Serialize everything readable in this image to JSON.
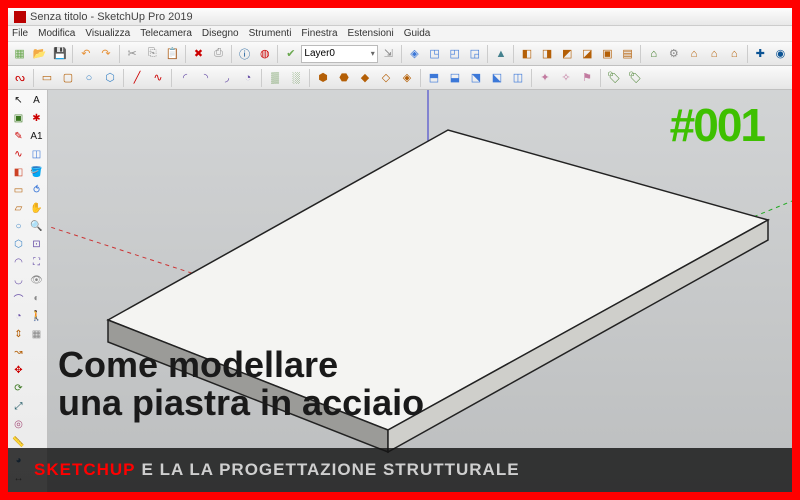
{
  "window": {
    "title": "Senza titolo - SketchUp Pro 2019"
  },
  "menu": {
    "items": [
      "File",
      "Modifica",
      "Visualizza",
      "Telecamera",
      "Disegno",
      "Strumenti",
      "Finestra",
      "Estensioni",
      "Guida"
    ]
  },
  "layer": {
    "current": "Layer0"
  },
  "overlay": {
    "episode": "#001",
    "title_line1": "Come modellare",
    "title_line2": "una piastra in acciaio",
    "strip_brand": "SKETCHUP",
    "strip_rest": "E LA LA PROGETTAZIONE STRUTTURALE"
  },
  "toolbar_main": [
    {
      "name": "new-icon",
      "glyph": "▦",
      "cls": "c-new"
    },
    {
      "name": "open-icon",
      "glyph": "📂",
      "cls": "c-open"
    },
    {
      "name": "save-icon",
      "glyph": "💾",
      "cls": "c-save"
    },
    {
      "name": "sep"
    },
    {
      "name": "undo-icon",
      "glyph": "↶",
      "cls": "c-undo"
    },
    {
      "name": "redo-icon",
      "glyph": "↷",
      "cls": "c-undo"
    },
    {
      "name": "sep"
    },
    {
      "name": "cut-icon",
      "glyph": "✂",
      "cls": "c-cut"
    },
    {
      "name": "copy-icon",
      "glyph": "⎘",
      "cls": "c-cut"
    },
    {
      "name": "paste-icon",
      "glyph": "📋",
      "cls": "c-paste"
    },
    {
      "name": "sep"
    },
    {
      "name": "delete-icon",
      "glyph": "✖",
      "cls": "c-del"
    },
    {
      "name": "print-icon",
      "glyph": "⎙",
      "cls": "c-cut"
    },
    {
      "name": "sep"
    },
    {
      "name": "model-info-icon",
      "glyph": "ⓘ",
      "cls": "c-tag"
    },
    {
      "name": "paint-icon",
      "glyph": "◍",
      "cls": "c-del"
    },
    {
      "name": "sep"
    },
    {
      "name": "layer-visible-icon",
      "glyph": "✔",
      "cls": "c-new"
    },
    {
      "name": "layer-selector"
    },
    {
      "name": "layer-manage-icon",
      "glyph": "⇲",
      "cls": "c-cut"
    },
    {
      "name": "sep"
    },
    {
      "name": "iso-icon",
      "glyph": "◈",
      "cls": "c-orbit"
    },
    {
      "name": "top-icon",
      "glyph": "◳",
      "cls": "c-orbit"
    },
    {
      "name": "front-icon",
      "glyph": "◰",
      "cls": "c-orbit"
    },
    {
      "name": "right-icon",
      "glyph": "◲",
      "cls": "c-orbit"
    },
    {
      "name": "sep"
    },
    {
      "name": "mirror-icon",
      "glyph": "▲",
      "cls": "c-mirror"
    },
    {
      "name": "sep"
    },
    {
      "name": "style1-icon",
      "glyph": "◧",
      "cls": "c-box"
    },
    {
      "name": "style2-icon",
      "glyph": "◨",
      "cls": "c-box"
    },
    {
      "name": "style3-icon",
      "glyph": "◩",
      "cls": "c-box"
    },
    {
      "name": "style4-icon",
      "glyph": "◪",
      "cls": "c-box"
    },
    {
      "name": "style5-icon",
      "glyph": "▣",
      "cls": "c-box"
    },
    {
      "name": "style6-icon",
      "glyph": "▤",
      "cls": "c-box"
    },
    {
      "name": "sep"
    },
    {
      "name": "warehouse-icon",
      "glyph": "⌂",
      "cls": "c-comp"
    },
    {
      "name": "extension-icon",
      "glyph": "⚙",
      "cls": "c-cut"
    },
    {
      "name": "house1-icon",
      "glyph": "⌂",
      "cls": "c-box"
    },
    {
      "name": "house2-icon",
      "glyph": "⌂",
      "cls": "c-box"
    },
    {
      "name": "house3-icon",
      "glyph": "⌂",
      "cls": "c-box"
    },
    {
      "name": "sep"
    },
    {
      "name": "addloc-icon",
      "glyph": "✚",
      "cls": "c-tag"
    },
    {
      "name": "geo-icon",
      "glyph": "◉",
      "cls": "c-tag"
    }
  ],
  "toolbar_sec": [
    {
      "name": "weld-icon",
      "glyph": "ᔓ",
      "cls": "c-del"
    },
    {
      "name": "sep"
    },
    {
      "name": "sb-rect-icon",
      "glyph": "▭",
      "cls": "c-rect"
    },
    {
      "name": "sb-rrect-icon",
      "glyph": "▢",
      "cls": "c-rect"
    },
    {
      "name": "sb-circle-icon",
      "glyph": "○",
      "cls": "c-circ"
    },
    {
      "name": "sb-poly-icon",
      "glyph": "⬡",
      "cls": "c-circ"
    },
    {
      "name": "sep"
    },
    {
      "name": "sb-line-icon",
      "glyph": "╱",
      "cls": "c-pencil"
    },
    {
      "name": "sb-free-icon",
      "glyph": "∿",
      "cls": "c-pencil"
    },
    {
      "name": "sep"
    },
    {
      "name": "sb-arc1-icon",
      "glyph": "◜",
      "cls": "c-arc"
    },
    {
      "name": "sb-arc2-icon",
      "glyph": "◝",
      "cls": "c-arc"
    },
    {
      "name": "sb-arc3-icon",
      "glyph": "◞",
      "cls": "c-arc"
    },
    {
      "name": "sb-pie-icon",
      "glyph": "◔",
      "cls": "c-arc"
    },
    {
      "name": "sep"
    },
    {
      "name": "sandbox1-icon",
      "glyph": "▒",
      "cls": "c-comp"
    },
    {
      "name": "sandbox2-icon",
      "glyph": "░",
      "cls": "c-comp"
    },
    {
      "name": "sep"
    },
    {
      "name": "sand-smoove-icon",
      "glyph": "⬢",
      "cls": "c-box"
    },
    {
      "name": "sand-stamp-icon",
      "glyph": "⬣",
      "cls": "c-box"
    },
    {
      "name": "sand-drape-icon",
      "glyph": "◆",
      "cls": "c-box"
    },
    {
      "name": "sand-add-icon",
      "glyph": "◇",
      "cls": "c-box"
    },
    {
      "name": "sand-flip-icon",
      "glyph": "◈",
      "cls": "c-box"
    },
    {
      "name": "sep"
    },
    {
      "name": "solid1-icon",
      "glyph": "⬒",
      "cls": "c-orbit"
    },
    {
      "name": "solid2-icon",
      "glyph": "⬓",
      "cls": "c-orbit"
    },
    {
      "name": "solid3-icon",
      "glyph": "⬔",
      "cls": "c-orbit"
    },
    {
      "name": "solid4-icon",
      "glyph": "⬕",
      "cls": "c-orbit"
    },
    {
      "name": "solid5-icon",
      "glyph": "◫",
      "cls": "c-orbit"
    },
    {
      "name": "sep"
    },
    {
      "name": "dyn1-icon",
      "glyph": "✦",
      "cls": "c-paste"
    },
    {
      "name": "dyn2-icon",
      "glyph": "✧",
      "cls": "c-paste"
    },
    {
      "name": "dyn3-icon",
      "glyph": "⚑",
      "cls": "c-paste"
    },
    {
      "name": "sep"
    },
    {
      "name": "tag1-icon",
      "glyph": "🏷",
      "cls": "c-comp"
    },
    {
      "name": "tag2-icon",
      "glyph": "🏷",
      "cls": "c-comp"
    }
  ],
  "sidebar": [
    {
      "name": "select-icon",
      "glyph": "↖",
      "cls": "c-sel"
    },
    {
      "name": "makecomp-icon",
      "glyph": "▣",
      "cls": "c-comp"
    },
    {
      "name": "line-icon",
      "glyph": "✎",
      "cls": "c-pencil"
    },
    {
      "name": "freehand-icon",
      "glyph": "∿",
      "cls": "c-pencil"
    },
    {
      "name": "eraser-icon",
      "glyph": "◧",
      "cls": "c-erase"
    },
    {
      "name": "rectangle-icon",
      "glyph": "▭",
      "cls": "c-rect"
    },
    {
      "name": "rotrect-icon",
      "glyph": "▱",
      "cls": "c-rect"
    },
    {
      "name": "circle-icon",
      "glyph": "○",
      "cls": "c-circ"
    },
    {
      "name": "polygon-icon",
      "glyph": "⬡",
      "cls": "c-circ"
    },
    {
      "name": "arc-icon",
      "glyph": "◠",
      "cls": "c-arc"
    },
    {
      "name": "arc2pt-icon",
      "glyph": "◡",
      "cls": "c-arc"
    },
    {
      "name": "arc3pt-icon",
      "glyph": "⌒",
      "cls": "c-arc"
    },
    {
      "name": "pie-icon",
      "glyph": "◔",
      "cls": "c-arc"
    },
    {
      "name": "pushpull-icon",
      "glyph": "⇕",
      "cls": "c-rect"
    },
    {
      "name": "followme-icon",
      "glyph": "↝",
      "cls": "c-rect"
    },
    {
      "name": "move-icon",
      "glyph": "✥",
      "cls": "c-move"
    },
    {
      "name": "rotate-icon",
      "glyph": "⟳",
      "cls": "c-rot"
    },
    {
      "name": "scale-icon",
      "glyph": "⤢",
      "cls": "c-scale"
    },
    {
      "name": "offset-icon",
      "glyph": "◎",
      "cls": "c-off"
    },
    {
      "name": "tape-icon",
      "glyph": "📏",
      "cls": "c-tape"
    },
    {
      "name": "protractor-icon",
      "glyph": "◕",
      "cls": "c-prot"
    },
    {
      "name": "dimension-icon",
      "glyph": "↔",
      "cls": "c-dim"
    },
    {
      "name": "text-icon",
      "glyph": "A",
      "cls": "c-text"
    },
    {
      "name": "axes-icon",
      "glyph": "✱",
      "cls": "c-move"
    },
    {
      "name": "text3d-icon",
      "glyph": "A1",
      "cls": "c-text"
    },
    {
      "name": "section-icon",
      "glyph": "◫",
      "cls": "c-orbit"
    },
    {
      "name": "paintbucket-icon",
      "glyph": "🪣",
      "cls": "c-paint"
    },
    {
      "name": "orbit-icon",
      "glyph": "⥀",
      "cls": "c-orbit"
    },
    {
      "name": "pan2-icon",
      "glyph": "✋",
      "cls": "c-pan"
    },
    {
      "name": "zoom2-icon",
      "glyph": "🔍",
      "cls": "c-zoom"
    },
    {
      "name": "zoomwin-icon",
      "glyph": "⊡",
      "cls": "c-zoom"
    },
    {
      "name": "zoomext-icon",
      "glyph": "⛶",
      "cls": "c-zoom"
    },
    {
      "name": "position-camera-icon",
      "glyph": "👁",
      "cls": "c-cut"
    },
    {
      "name": "lookaround-icon",
      "glyph": "◐",
      "cls": "c-cut"
    },
    {
      "name": "walk-icon",
      "glyph": "🚶",
      "cls": "c-cut"
    },
    {
      "name": "sectionfill-icon",
      "glyph": "▦",
      "cls": "c-cut"
    }
  ]
}
